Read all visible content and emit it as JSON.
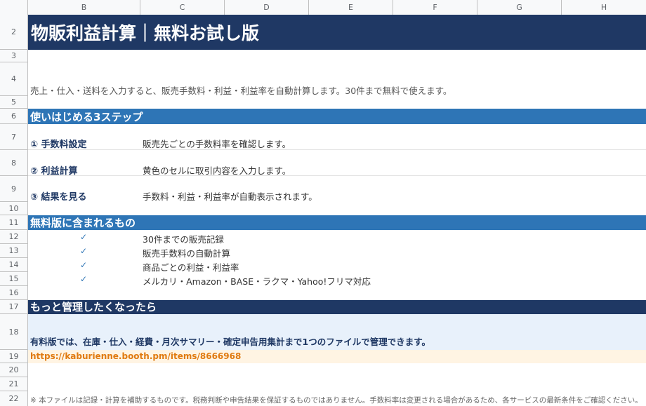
{
  "columns": [
    "B",
    "C",
    "D",
    "E",
    "F",
    "G",
    "H"
  ],
  "rows": [
    "2",
    "3",
    "4",
    "5",
    "6",
    "7",
    "8",
    "9",
    "10",
    "11",
    "12",
    "13",
    "14",
    "15",
    "16",
    "17",
    "18",
    "19",
    "20",
    "21",
    "22"
  ],
  "title": "物販利益計算｜無料お試し版",
  "intro": "売上・仕入・送料を入力すると、販売手数料・利益・利益率を自動計算します。30件まで無料で使えます。",
  "steps_heading": "使いはじめる3ステップ",
  "steps": [
    {
      "label": "① 手数料設定",
      "desc": "販売先ごとの手数料率を確認します。"
    },
    {
      "label": "② 利益計算",
      "desc": "黄色のセルに取引内容を入力します。"
    },
    {
      "label": "③ 結果を見る",
      "desc": "手数料・利益・利益率が自動表示されます。"
    }
  ],
  "features_heading": "無料版に含まれるもの",
  "check_mark": "✓",
  "features": [
    "30件までの販売記録",
    "販売手数料の自動計算",
    "商品ごとの利益・利益率",
    "メルカリ・Amazon・BASE・ラクマ・Yahoo!フリマ対応"
  ],
  "upgrade_heading": "もっと管理したくなったら",
  "upgrade_text": "有料版では、在庫・仕入・経費・月次サマリー・確定申告用集計まで1つのファイルで管理できます。",
  "link": "https://kaburienne.booth.pm/items/8666968",
  "footnote": "※ 本ファイルは記録・計算を補助するものです。税務判断や申告結果を保証するものではありません。手数料率は変更される場合があるため、各サービスの最新条件をご確認ください。",
  "colors": {
    "navy": "#1f3864",
    "blue": "#2e75b6",
    "link_orange": "#e07a10",
    "note_bg": "#e8f1fb",
    "link_bg": "#fff4e3"
  }
}
